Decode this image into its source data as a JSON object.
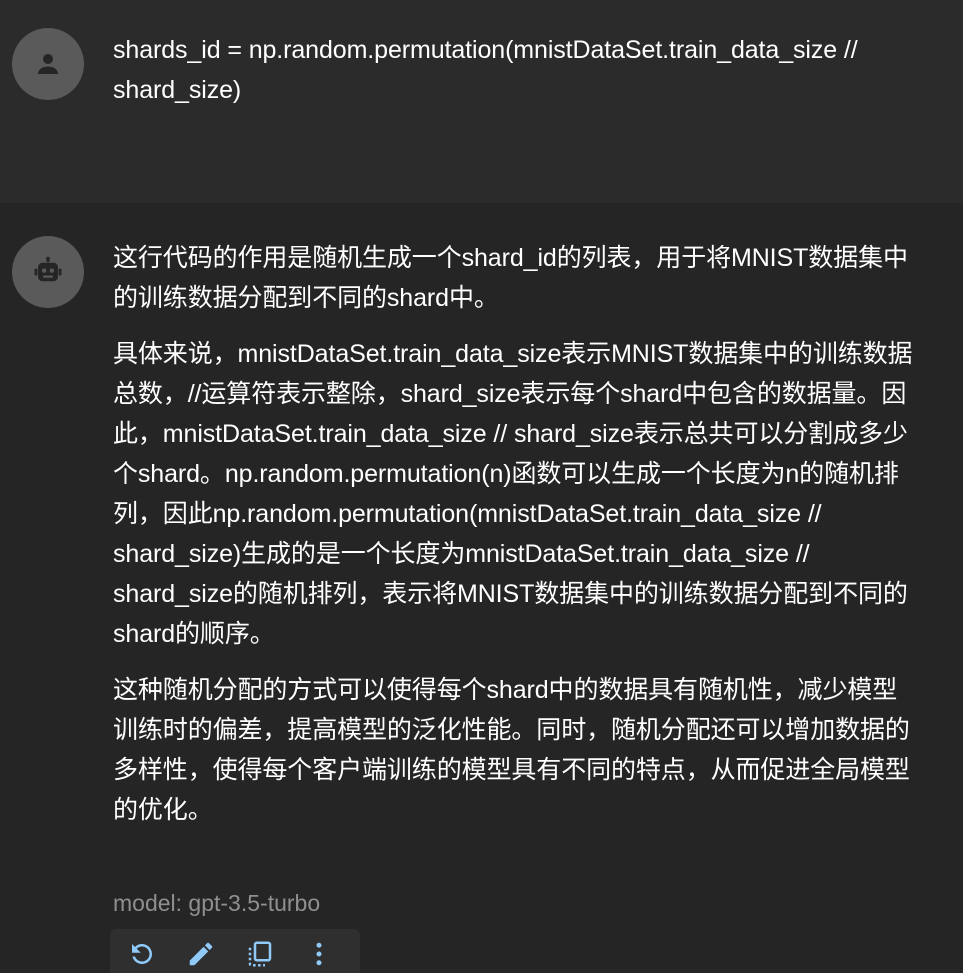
{
  "colors": {
    "user_bg": "#2b2b2b",
    "assistant_bg": "#252525",
    "avatar_bg": "#5a5a5a",
    "icon_blue": "#90caf9",
    "muted_text": "#8f8f8f"
  },
  "user_message": {
    "avatar_icon": "person-icon",
    "text": "shards_id = np.random.permutation(mnistDataSet.train_data_size // shard_size)"
  },
  "assistant_message": {
    "avatar_icon": "robot-icon",
    "paragraphs": [
      "这行代码的作用是随机生成一个shard_id的列表，用于将MNIST数据集中的训练数据分配到不同的shard中。",
      "具体来说，mnistDataSet.train_data_size表示MNIST数据集中的训练数据总数，//运算符表示整除，shard_size表示每个shard中包含的数据量。因此，mnistDataSet.train_data_size // shard_size表示总共可以分割成多少个shard。np.random.permutation(n)函数可以生成一个长度为n的随机排列，因此np.random.permutation(mnistDataSet.train_data_size // shard_size)生成的是一个长度为mnistDataSet.train_data_size // shard_size的随机排列，表示将MNIST数据集中的训练数据分配到不同的shard的顺序。",
      "这种随机分配的方式可以使得每个shard中的数据具有随机性，减少模型训练时的偏差，提高模型的泛化性能。同时，随机分配还可以增加数据的多样性，使得每个客户端训练的模型具有不同的特点，从而促进全局模型的优化。"
    ],
    "model_label": "model: gpt-3.5-turbo",
    "actions": [
      {
        "icon": "refresh-icon"
      },
      {
        "icon": "edit-icon"
      },
      {
        "icon": "copy-icon"
      },
      {
        "icon": "more-vertical-icon"
      }
    ]
  }
}
